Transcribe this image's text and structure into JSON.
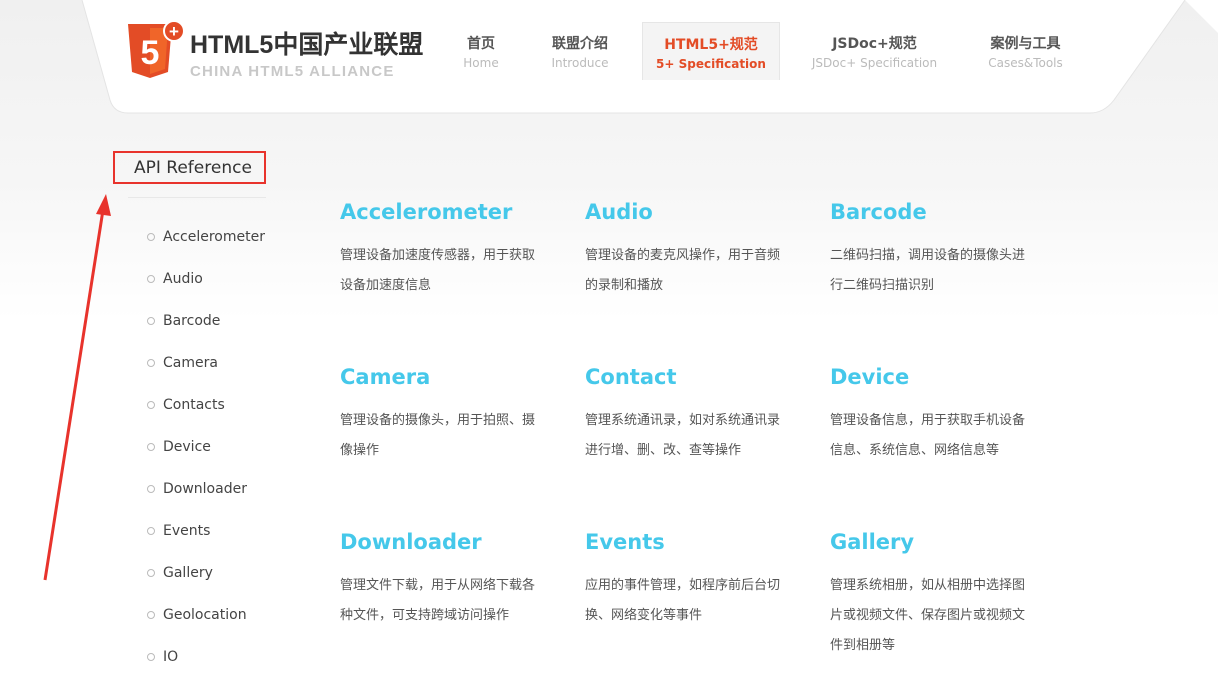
{
  "brand": {
    "title": "HTML5中国产业联盟",
    "subtitle": "CHINA HTML5 ALLIANCE",
    "shield_digit": "5",
    "shield_plus": "+",
    "accent": "#e34c26"
  },
  "nav": [
    {
      "zh": "首页",
      "en": "Home",
      "active": false
    },
    {
      "zh": "联盟介绍",
      "en": "Introduce",
      "active": false
    },
    {
      "zh": "HTML5+规范",
      "en": "5+ Specification",
      "active": true
    },
    {
      "zh": "JSDoc+规范",
      "en": "JSDoc+ Specification",
      "active": false
    },
    {
      "zh": "案例与工具",
      "en": "Cases&Tools",
      "active": false
    }
  ],
  "sidebar": {
    "title": "API Reference",
    "items": [
      "Accelerometer",
      "Audio",
      "Barcode",
      "Camera",
      "Contacts",
      "Device",
      "Downloader",
      "Events",
      "Gallery",
      "Geolocation",
      "IO"
    ]
  },
  "cards": [
    {
      "title": "Accelerometer",
      "desc": "管理设备加速度传感器，用于获取设备加速度信息"
    },
    {
      "title": "Audio",
      "desc": "管理设备的麦克风操作，用于音频的录制和播放"
    },
    {
      "title": "Barcode",
      "desc": "二维码扫描，调用设备的摄像头进行二维码扫描识别"
    },
    {
      "title": "Camera",
      "desc": "管理设备的摄像头，用于拍照、摄像操作"
    },
    {
      "title": "Contact",
      "desc": "管理系统通讯录，如对系统通讯录进行增、删、改、查等操作"
    },
    {
      "title": "Device",
      "desc": "管理设备信息，用于获取手机设备信息、系统信息、网络信息等"
    },
    {
      "title": "Downloader",
      "desc": "管理文件下载，用于从网络下载各种文件，可支持跨域访问操作"
    },
    {
      "title": "Events",
      "desc": "应用的事件管理，如程序前后台切换、网络变化等事件"
    },
    {
      "title": "Gallery",
      "desc": "管理系统相册，如从相册中选择图片或视频文件、保存图片或视频文件到相册等"
    }
  ],
  "colors": {
    "link": "#45c8ea",
    "highlight_box": "#e8332c"
  }
}
